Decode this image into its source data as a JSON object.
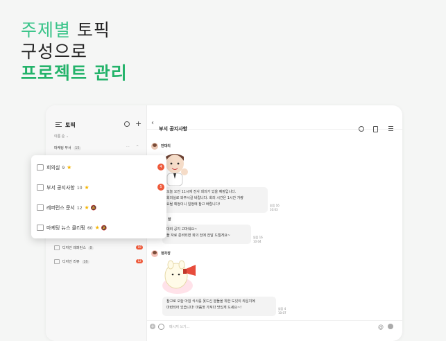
{
  "headline": {
    "line1_accent": "주제별",
    "line1_rest": " 토픽",
    "line2": "구성으로",
    "line3": "프로젝트 관리"
  },
  "sidebar": {
    "title": "토픽",
    "sort": "이름 순 ⌄",
    "group": {
      "name": "마케팅 부서",
      "count": "15"
    },
    "items": [
      {
        "label": "디자인 레퍼런스",
        "count": "8",
        "badge": "10"
      },
      {
        "label": "디자인 리뷰",
        "count": "16",
        "badge": "12"
      }
    ]
  },
  "popup": {
    "items": [
      {
        "label": "회의실",
        "count": "9",
        "star": "★",
        "mute": "",
        "badge": "4"
      },
      {
        "label": "부서 공지사항",
        "count": "10",
        "star": "★",
        "mute": "",
        "badge": "5"
      },
      {
        "label": "레퍼런스 문서",
        "count": "12",
        "star": "★",
        "mute": "🔕",
        "badge": ""
      },
      {
        "label": "마케팅 뉴스 클리핑",
        "count": "60",
        "star": "★",
        "mute": "🔕",
        "badge": ""
      }
    ]
  },
  "chat": {
    "title": "부서 공지사항",
    "back": "‹",
    "messages": [
      {
        "sender": "안대리",
        "text1": "오늘 오전 11시에 전사 회의가 있을 예정입니다.",
        "text2": "회의실로 와주시길 바랍니다. 회의 시간은 1시간 가량",
        "text3": "요될 예정이니 일정에 참고 바랍니다!",
        "read": "읽음 16",
        "time": "10:03"
      },
      {
        "sender": "장",
        "text1": "대리 공지 고마워요~",
        "text2": "들 자료 준비되면 회의 전에 전달 드릴게요~",
        "read": "읽음 16",
        "time": "10:04"
      },
      {
        "sender": "정차장",
        "text1": "참고로 오늘 아침 식사를 못드신 분들을 위한 도넛이 라운지에",
        "text2": "마련되어 있습니다! 마음껏 가져다 맛있게 드세요~!",
        "read": "읽음 4",
        "time": "10:07"
      }
    ],
    "composer_placeholder": "메시지 쓰기..."
  },
  "colors": {
    "accent": "#3bc48a",
    "accent_bold": "#23b36a",
    "badge": "#ee5a3b",
    "star": "#f5b400"
  }
}
